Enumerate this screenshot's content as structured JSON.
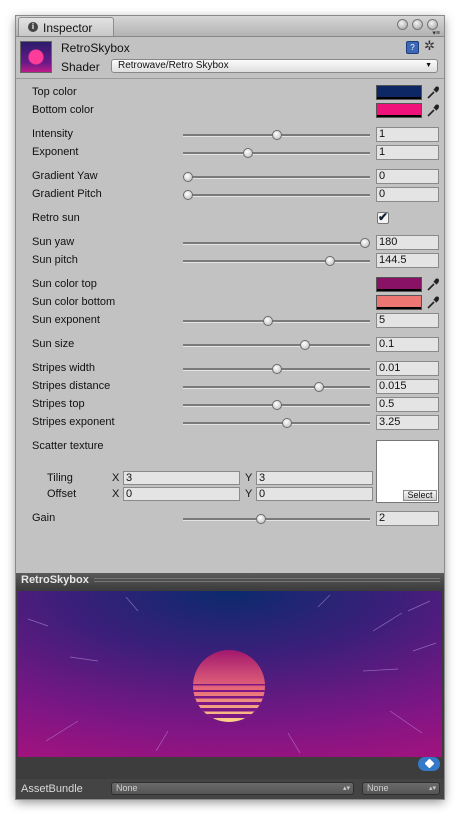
{
  "window": {
    "tab_label": "Inspector",
    "info_icon_glyph": "i"
  },
  "material": {
    "name": "RetroSkybox",
    "shader_label": "Shader",
    "shader_value": "Retrowave/Retro Skybox"
  },
  "properties": {
    "top_color": {
      "label": "Top color",
      "color": "#0d2664"
    },
    "bottom_color": {
      "label": "Bottom color",
      "color": "#f0127a"
    },
    "intensity": {
      "label": "Intensity",
      "value": "1",
      "level": 0.5
    },
    "exponent": {
      "label": "Exponent",
      "value": "1",
      "level": 0.34
    },
    "gradient_yaw": {
      "label": "Gradient Yaw",
      "value": "0",
      "level": 0.0
    },
    "gradient_pitch": {
      "label": "Gradient Pitch",
      "value": "0",
      "level": 0.0
    },
    "retro_sun": {
      "label": "Retro sun",
      "checked": true,
      "check_glyph": "✔"
    },
    "sun_yaw": {
      "label": "Sun yaw",
      "value": "180",
      "level": 1.0
    },
    "sun_pitch": {
      "label": "Sun pitch",
      "value": "144.5",
      "level": 0.8
    },
    "sun_color_top": {
      "label": "Sun color top",
      "color": "#8a1266"
    },
    "sun_color_bottom": {
      "label": "Sun color bottom",
      "color": "#ec7672"
    },
    "sun_exponent": {
      "label": "Sun exponent",
      "value": "5",
      "level": 0.45
    },
    "sun_size": {
      "label": "Sun size",
      "value": "0.1",
      "level": 0.66
    },
    "stripes_width": {
      "label": "Stripes width",
      "value": "0.01",
      "level": 0.5
    },
    "stripes_distance": {
      "label": "Stripes distance",
      "value": "0.015",
      "level": 0.74
    },
    "stripes_top": {
      "label": "Stripes top",
      "value": "0.5",
      "level": 0.5
    },
    "stripes_exponent": {
      "label": "Stripes exponent",
      "value": "3.25",
      "level": 0.56
    },
    "scatter_texture": {
      "label": "Scatter texture",
      "select_label": "Select",
      "tiling_label": "Tiling",
      "offset_label": "Offset",
      "x_label": "X",
      "y_label": "Y",
      "tiling_x": "3",
      "tiling_y": "3",
      "offset_x": "0",
      "offset_y": "0"
    },
    "gain": {
      "label": "Gain",
      "value": "2",
      "level": 0.41
    }
  },
  "preview": {
    "title": "RetroSkybox"
  },
  "asset_bundle": {
    "label": "AssetBundle",
    "bundle_value": "None",
    "variant_value": "None"
  }
}
